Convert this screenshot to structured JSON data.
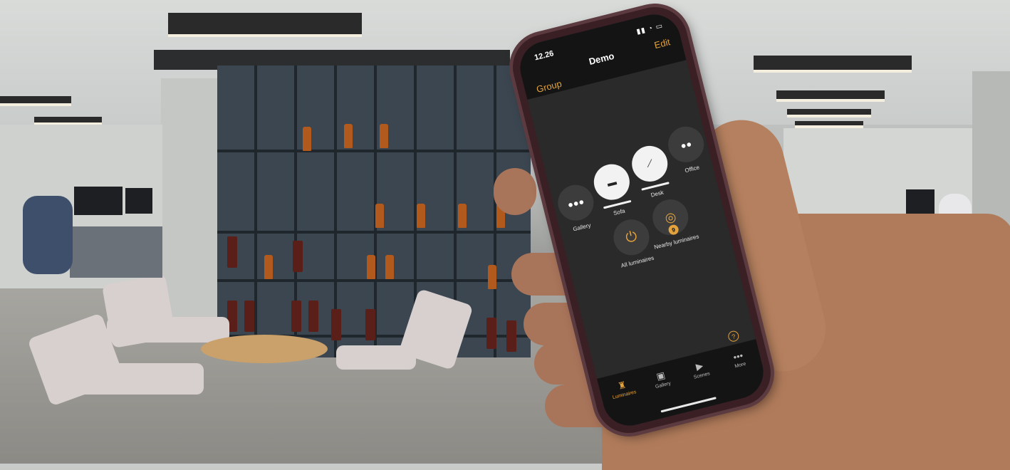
{
  "status_bar": {
    "time": "12.26",
    "icons": "signal-icon wifi-icon battery-icon"
  },
  "header": {
    "title": "Demo",
    "edit_label": "Edit",
    "group_label": "Group"
  },
  "luminaires": [
    {
      "label": "Gallery",
      "icon": "three-bulbs-icon",
      "active": false
    },
    {
      "label": "Sofa",
      "icon": "floor-lamp-shade-icon",
      "active": true
    },
    {
      "label": "Desk",
      "icon": "desk-lamp-icon",
      "active": true
    },
    {
      "label": "Office",
      "icon": "four-bulbs-icon",
      "active": false
    },
    {
      "label": "All luminaires",
      "icon": "power-icon",
      "active": false
    },
    {
      "label": "Nearby luminaires",
      "icon": "nearby-signal-icon",
      "badge": "9",
      "active": false
    }
  ],
  "tabs": [
    {
      "label": "Luminaires",
      "icon": "lamp-icon",
      "active": true
    },
    {
      "label": "Gallery",
      "icon": "gallery-icon",
      "active": false
    },
    {
      "label": "Scenes",
      "icon": "scenes-icon",
      "active": false
    },
    {
      "label": "More",
      "icon": "more-icon",
      "active": false
    }
  ],
  "colors": {
    "accent": "#e4a23c",
    "screen_bg": "#2a2a2a",
    "bar_bg": "#141414",
    "tile_bg": "#3c3c3c",
    "tile_active": "#f2f2f2"
  }
}
